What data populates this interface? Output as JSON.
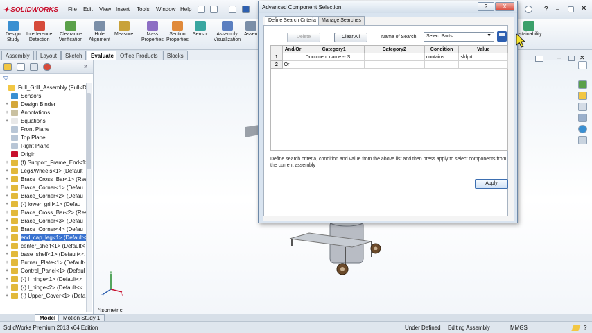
{
  "app": {
    "logo": "SOLIDWORKS",
    "menu": [
      "File",
      "Edit",
      "View",
      "Insert",
      "Tools",
      "Window",
      "Help"
    ]
  },
  "command_manager": {
    "items": [
      {
        "label": "Design\nStudy",
        "icon": "design-study-icon"
      },
      {
        "label": "Interference\nDetection",
        "icon": "interference-icon"
      },
      {
        "label": "Clearance\nVerification",
        "icon": "clearance-icon"
      },
      {
        "label": "Hole\nAlignment",
        "icon": "hole-icon"
      },
      {
        "label": "Measure",
        "icon": "measure-icon"
      },
      {
        "label": "Mass\nProperties",
        "icon": "mass-icon"
      },
      {
        "label": "Section\nProperties",
        "icon": "section-icon"
      },
      {
        "label": "Sensor",
        "icon": "sensor-icon"
      },
      {
        "label": "Assembly\nVisualization",
        "icon": "assembly-vis-icon"
      },
      {
        "label": "Assen",
        "icon": "assembly-icon"
      },
      {
        "label": "ustainability",
        "icon": "sustainability-icon"
      }
    ],
    "tabs": [
      "Assembly",
      "Layout",
      "Sketch",
      "Evaluate",
      "Office Products",
      "Blocks"
    ],
    "active_tab": "Evaluate"
  },
  "tree": {
    "items": [
      {
        "label": "Full_Grill_Assembly  (Full<Dis",
        "icon": "assembly-icon",
        "exp": ""
      },
      {
        "label": "Sensors",
        "icon": "sensor-icon",
        "exp": ""
      },
      {
        "label": "Design Binder",
        "icon": "binder-icon",
        "exp": "+"
      },
      {
        "label": "Annotations",
        "icon": "annotation-icon",
        "exp": "+"
      },
      {
        "label": "Equations",
        "icon": "equation-icon",
        "exp": "+"
      },
      {
        "label": "Front Plane",
        "icon": "plane-icon",
        "exp": ""
      },
      {
        "label": "Top Plane",
        "icon": "plane-icon",
        "exp": ""
      },
      {
        "label": "Right Plane",
        "icon": "plane-icon",
        "exp": ""
      },
      {
        "label": "Origin",
        "icon": "origin-icon",
        "exp": ""
      },
      {
        "label": "(f) Support_Frame_End<1>",
        "icon": "part-icon",
        "exp": "+"
      },
      {
        "label": "Leg&Wheels<1> (Default",
        "icon": "part-icon",
        "exp": "+"
      },
      {
        "label": "Brace_Cross_Bar<1> (Rea",
        "icon": "part-icon",
        "exp": "+"
      },
      {
        "label": "Brace_Corner<1> (Defau",
        "icon": "part-icon",
        "exp": "+"
      },
      {
        "label": "Brace_Corner<2> (Defau",
        "icon": "part-icon",
        "exp": "+"
      },
      {
        "label": "(-) lower_grill<1> (Defau",
        "icon": "part-icon",
        "exp": "+"
      },
      {
        "label": "Brace_Cross_Bar<2> (Rea",
        "icon": "part-icon",
        "exp": "+"
      },
      {
        "label": "Brace_Corner<3> (Defau",
        "icon": "part-icon",
        "exp": "+"
      },
      {
        "label": "Brace_Corner<4> (Defau",
        "icon": "part-icon",
        "exp": "+"
      },
      {
        "label": "end_cap_leg<1> (Default<",
        "icon": "part-icon",
        "exp": "+",
        "selected": true
      },
      {
        "label": "center_shelf<1> (Default<",
        "icon": "part-icon",
        "exp": "+"
      },
      {
        "label": "base_shelf<1> (Default<<",
        "icon": "part-icon",
        "exp": "+"
      },
      {
        "label": "Burner_Plate<1> (Default-",
        "icon": "part-icon",
        "exp": "+"
      },
      {
        "label": "Control_Panel<1> (Defaul",
        "icon": "part-icon",
        "exp": "+"
      },
      {
        "label": "(-) l_hinge<1> (Default<<",
        "icon": "part-icon",
        "exp": "+"
      },
      {
        "label": "(-) l_hinge<2> (Default<<",
        "icon": "part-icon",
        "exp": "+"
      },
      {
        "label": "(-) Upper_Cover<1> (Defa",
        "icon": "part-icon",
        "exp": "+"
      }
    ]
  },
  "dialog": {
    "title": "Advanced Component Selection",
    "tabs": [
      "Define Search Criteria",
      "Manage Searches"
    ],
    "delete_label": "Delete",
    "clear_label": "Clear All",
    "name_label": "Name of Search:",
    "name_value": "Select Parts",
    "columns": [
      "",
      "And/Or",
      "Category1",
      "Category2",
      "Condition",
      "Value"
    ],
    "rows": [
      [
        "1",
        "",
        "Document name -- S",
        "",
        "contains",
        "sldprt"
      ],
      [
        "2",
        "Or",
        "",
        "",
        "",
        ""
      ]
    ],
    "help": "Define search criteria, condition and value from the above list and then press apply to select components from the current assembly",
    "apply_label": "Apply",
    "help_btn": "?",
    "close_btn": "X"
  },
  "viewport": {
    "view_label": "*Isometric",
    "triad": {
      "x": "X",
      "y": "Y",
      "z": "Z"
    }
  },
  "bottom_tabs": [
    "Model",
    "Motion Study 1"
  ],
  "status": {
    "edition": "SolidWorks Premium 2013 x64 Edition",
    "state": "Under Defined",
    "mode": "Editing Assembly",
    "units": "MMGS",
    "help": "?"
  },
  "colors": {
    "accent": "#3a73d0",
    "part_icon": "#e2b93b",
    "selection": "#3a73d0"
  }
}
